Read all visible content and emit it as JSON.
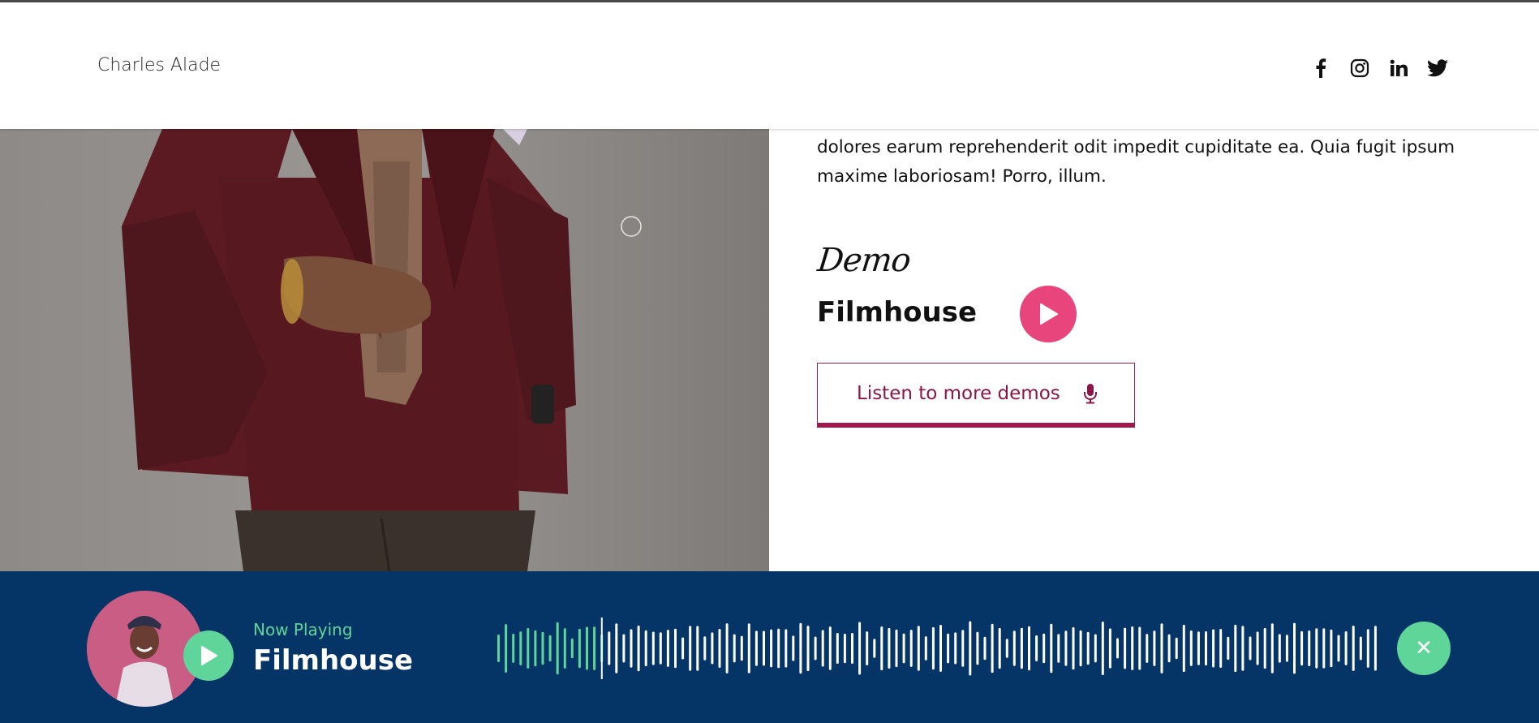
{
  "header": {
    "brand": "Charles Alade",
    "socials": [
      {
        "name": "facebook-icon"
      },
      {
        "name": "instagram-icon"
      },
      {
        "name": "linkedin-icon"
      },
      {
        "name": "twitter-icon"
      }
    ]
  },
  "about": {
    "bio": "voluptatibus sint omnis fugiat recusandae ab ipsam quidem voluptatum atque dolores earum reprehenderit odit impedit cupiditate ea. Quia fugit ipsum maxime laboriosam! Porro, illum."
  },
  "demo": {
    "heading": "Demo",
    "title": "Filmhouse",
    "more_label": "Listen to more demos"
  },
  "player": {
    "now_label": "Now Playing",
    "title": "Filmhouse",
    "progress": 0.12
  },
  "colors": {
    "accent_pink": "#e8457c",
    "button_maroon": "#8c1547",
    "player_bg": "#043566",
    "player_green": "#5fd59a"
  }
}
